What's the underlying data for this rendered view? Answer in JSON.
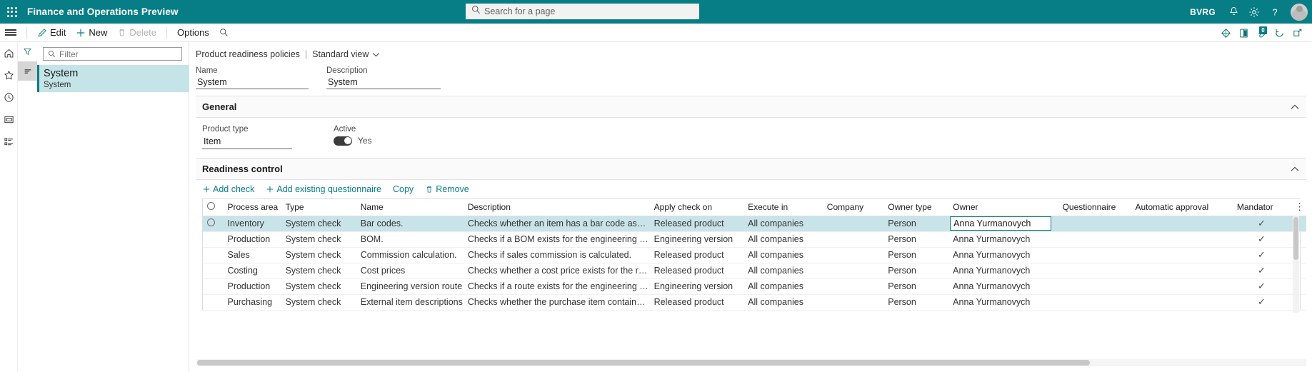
{
  "topbar": {
    "app_title": "Finance and Operations Preview",
    "waffle_icon": "app-launcher-icon",
    "search_placeholder": "Search for a page",
    "search_value": "",
    "search_icon": "search-icon",
    "company": "BVRG",
    "notification_icon": "bell-icon",
    "settings_icon": "gear-icon",
    "help_icon": "question-mark-icon",
    "avatar_icon": "user-avatar"
  },
  "commandbar": {
    "menu_icon": "hamburger-menu-icon",
    "edit_label": "Edit",
    "edit_icon": "pencil-icon",
    "new_label": "New",
    "new_icon": "plus-icon",
    "delete_label": "Delete",
    "delete_icon": "trash-icon",
    "options_label": "Options",
    "search_icon": "search-icon",
    "right_icons": [
      {
        "name": "share-icon",
        "badge": ""
      },
      {
        "name": "open-in-office-icon",
        "badge": ""
      },
      {
        "name": "attachments-icon",
        "badge": "0"
      },
      {
        "name": "refresh-icon",
        "badge": ""
      },
      {
        "name": "popout-icon",
        "badge": ""
      }
    ]
  },
  "rail": {
    "items": [
      {
        "name": "home-icon"
      },
      {
        "name": "favorites-star-icon"
      },
      {
        "name": "recent-clock-icon"
      },
      {
        "name": "workspaces-icon"
      },
      {
        "name": "modules-list-icon"
      }
    ]
  },
  "pane": {
    "filter_icon": "filter-funnel-icon",
    "sort_icon": "sort-lines-icon",
    "filter_placeholder": "Filter",
    "filter_value": "",
    "list": [
      {
        "primary": "System",
        "secondary": "System"
      }
    ]
  },
  "breadcrumb": {
    "page": "Product readiness policies",
    "separator": "|",
    "view": "Standard view",
    "chevron_icon": "chevron-down-icon"
  },
  "header_fields": {
    "name_label": "Name",
    "name_value": "System",
    "description_label": "Description",
    "description_value": "System"
  },
  "general": {
    "section_title": "General",
    "collapse_icon": "chevron-up-icon",
    "product_type_label": "Product type",
    "product_type_value": "Item",
    "active_label": "Active",
    "active_toggle_state": "Yes"
  },
  "readiness": {
    "section_title": "Readiness control",
    "collapse_icon": "chevron-up-icon",
    "toolbar": [
      {
        "label": "Add check",
        "icon": "plus-icon"
      },
      {
        "label": "Add existing questionnaire",
        "icon": "plus-icon"
      },
      {
        "label": "Copy",
        "icon": ""
      },
      {
        "label": "Remove",
        "icon": "trash-icon"
      }
    ],
    "columns": [
      "Process area",
      "Type",
      "Name",
      "Description",
      "Apply check on",
      "Execute in",
      "Company",
      "Owner type",
      "Owner",
      "Questionnaire",
      "Automatic approval",
      "Mandator"
    ],
    "kebab_icon": "more-options-icon",
    "select_all_icon": "row-select-circle-icon",
    "rows": [
      {
        "process_area": "Inventory",
        "type": "System check",
        "name": "Bar codes.",
        "description": "Checks whether an item has a bar code associ...",
        "apply_check_on": "Released product",
        "execute_in": "All companies",
        "company": "",
        "owner_type": "Person",
        "owner": "Anna Yurmanovych",
        "questionnaire": "",
        "automatic_approval": "",
        "mandatory": "✓",
        "selected": true,
        "owner_editing": true
      },
      {
        "process_area": "Production",
        "type": "System check",
        "name": "BOM.",
        "description": "Checks if a BOM exists for the engineering ve...",
        "apply_check_on": "Engineering version",
        "execute_in": "All companies",
        "company": "",
        "owner_type": "Person",
        "owner": "Anna Yurmanovych",
        "questionnaire": "",
        "automatic_approval": "",
        "mandatory": "✓",
        "selected": false,
        "owner_editing": false
      },
      {
        "process_area": "Sales",
        "type": "System check",
        "name": "Commission calculation.",
        "description": "Checks if sales commission is calculated.",
        "apply_check_on": "Released product",
        "execute_in": "All companies",
        "company": "",
        "owner_type": "Person",
        "owner": "Anna Yurmanovych",
        "questionnaire": "",
        "automatic_approval": "",
        "mandatory": "✓",
        "selected": false,
        "owner_editing": false
      },
      {
        "process_area": "Costing",
        "type": "System check",
        "name": "Cost prices",
        "description": "Checks whether a cost price exists for the rele...",
        "apply_check_on": "Released product",
        "execute_in": "All companies",
        "company": "",
        "owner_type": "Person",
        "owner": "Anna Yurmanovych",
        "questionnaire": "",
        "automatic_approval": "",
        "mandatory": "✓",
        "selected": false,
        "owner_editing": false
      },
      {
        "process_area": "Production",
        "type": "System check",
        "name": "Engineering version route",
        "description": "Checks if a route exists for the engineering ve...",
        "apply_check_on": "Engineering version",
        "execute_in": "All companies",
        "company": "",
        "owner_type": "Person",
        "owner": "Anna Yurmanovych",
        "questionnaire": "",
        "automatic_approval": "",
        "mandatory": "✓",
        "selected": false,
        "owner_editing": false
      },
      {
        "process_area": "Purchasing",
        "type": "System check",
        "name": "External item descriptions",
        "description": "Checks whether the purchase item contains a...",
        "apply_check_on": "Released product",
        "execute_in": "All companies",
        "company": "",
        "owner_type": "Person",
        "owner": "Anna Yurmanovych",
        "questionnaire": "",
        "automatic_approval": "",
        "mandatory": "✓",
        "selected": false,
        "owner_editing": false
      }
    ]
  },
  "colors": {
    "brand_teal": "#077d86",
    "selection_row": "#c9e4e9",
    "link_teal": "#0a7d86"
  }
}
